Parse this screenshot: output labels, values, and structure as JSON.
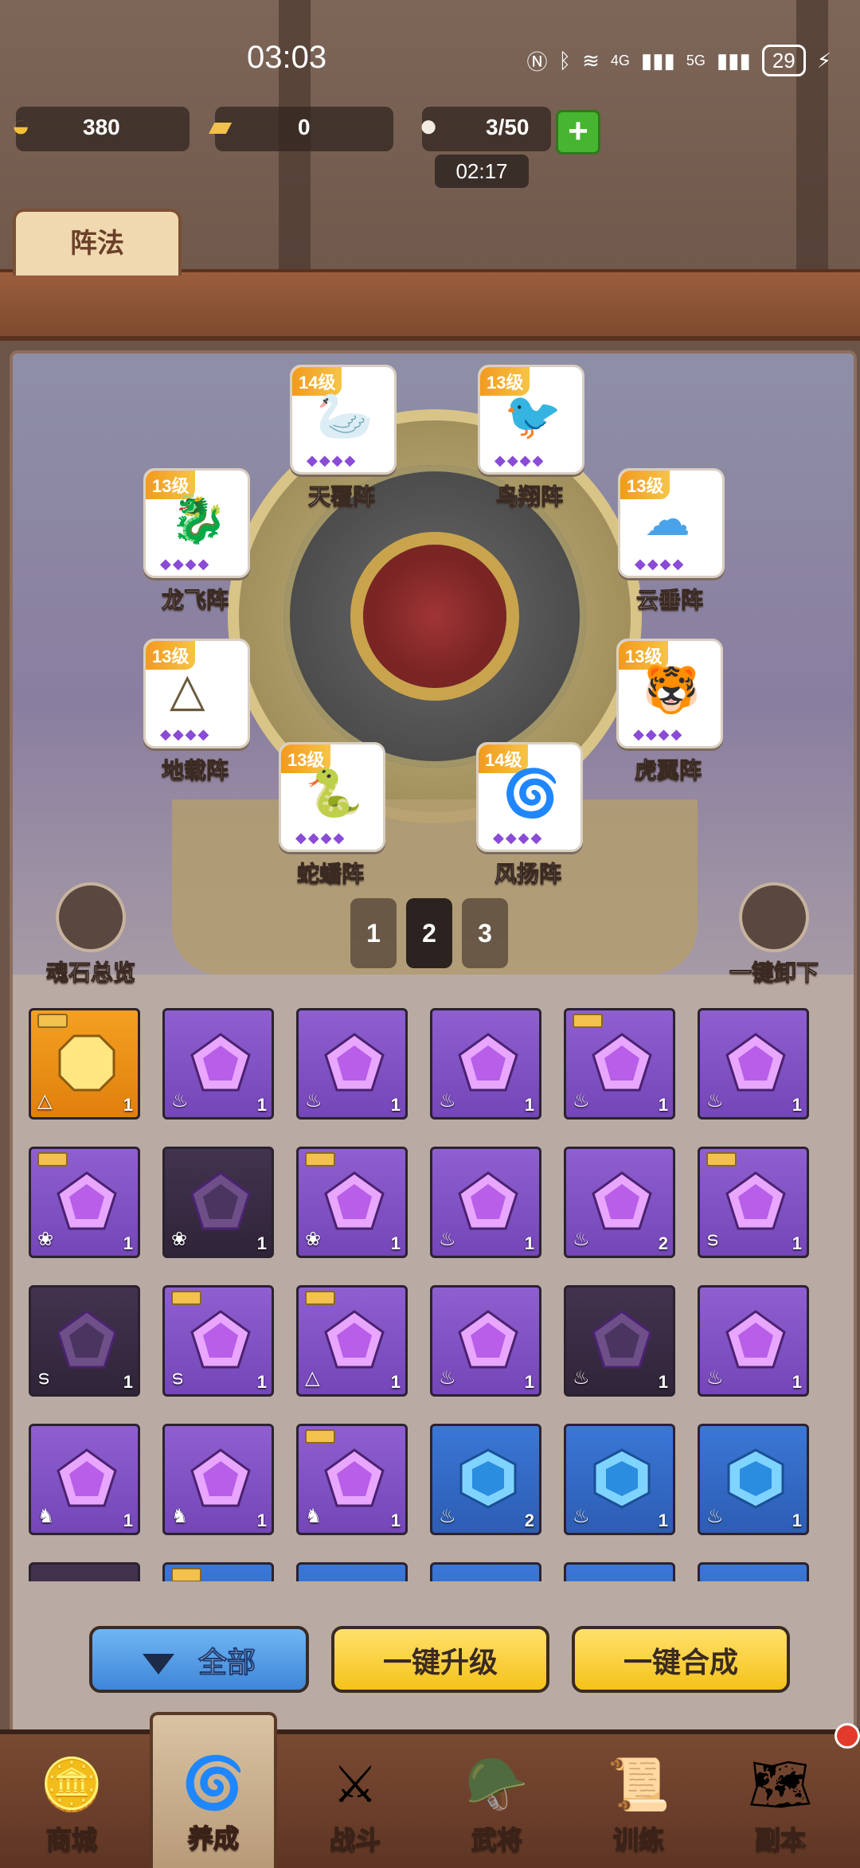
{
  "status": {
    "time": "03:03",
    "network": "4G",
    "network2": "5G",
    "battery": "29"
  },
  "resources": {
    "gold": "380",
    "ticket": "0",
    "stamina": "3/50",
    "timer": "02:17"
  },
  "tab": {
    "title": "阵法"
  },
  "formations": [
    {
      "name": "天覆阵",
      "level": "14级",
      "glyph": "🦢",
      "color": "#d9c06a",
      "gems": "◆◆◆◆"
    },
    {
      "name": "鸟翔阵",
      "level": "13级",
      "glyph": "🐦",
      "color": "#c62d2d",
      "gems": "◆◆◆◆"
    },
    {
      "name": "龙飞阵",
      "level": "13级",
      "glyph": "🐉",
      "color": "#e88a2a",
      "gems": "◆◆◆◆"
    },
    {
      "name": "云垂阵",
      "level": "13级",
      "glyph": "☁",
      "color": "#4aa3e8",
      "gems": "◆◆◆◆"
    },
    {
      "name": "地载阵",
      "level": "13级",
      "glyph": "△",
      "color": "#6b5a3c",
      "gems": "◆◆◆◆"
    },
    {
      "name": "虎翼阵",
      "level": "13级",
      "glyph": "🐯",
      "color": "#e8b14a",
      "gems": "◆◆◆◆"
    },
    {
      "name": "蛇蟠阵",
      "level": "13级",
      "glyph": "🐍",
      "color": "#8a4bd6",
      "gems": "◆◆◆◆"
    },
    {
      "name": "风扬阵",
      "level": "14级",
      "glyph": "🌀",
      "color": "#2fb88a",
      "gems": "◆◆◆◆"
    }
  ],
  "pages": [
    "1",
    "2",
    "3"
  ],
  "side": {
    "left": "魂石总览",
    "right": "一键卸下"
  },
  "gems": [
    {
      "t": "orange",
      "c": "1",
      "s": "△",
      "tag": true
    },
    {
      "t": "purple",
      "c": "1",
      "s": "♨",
      "tag": false
    },
    {
      "t": "purple",
      "c": "1",
      "s": "♨",
      "tag": false
    },
    {
      "t": "purple",
      "c": "1",
      "s": "♨",
      "tag": false
    },
    {
      "t": "purple",
      "c": "1",
      "s": "♨",
      "tag": true
    },
    {
      "t": "purple",
      "c": "1",
      "s": "♨",
      "tag": false
    },
    {
      "t": "purple",
      "c": "1",
      "s": "❀",
      "tag": true
    },
    {
      "t": "dark",
      "c": "1",
      "s": "❀",
      "tag": false
    },
    {
      "t": "purple",
      "c": "1",
      "s": "❀",
      "tag": true
    },
    {
      "t": "purple",
      "c": "1",
      "s": "♨",
      "tag": false
    },
    {
      "t": "purple",
      "c": "2",
      "s": "♨",
      "tag": false
    },
    {
      "t": "purple",
      "c": "1",
      "s": "ട",
      "tag": true
    },
    {
      "t": "dark",
      "c": "1",
      "s": "ട",
      "tag": false
    },
    {
      "t": "purple",
      "c": "1",
      "s": "ട",
      "tag": true
    },
    {
      "t": "purple",
      "c": "1",
      "s": "△",
      "tag": true
    },
    {
      "t": "purple",
      "c": "1",
      "s": "♨",
      "tag": false
    },
    {
      "t": "dark",
      "c": "1",
      "s": "♨",
      "tag": false
    },
    {
      "t": "purple",
      "c": "1",
      "s": "♨",
      "tag": false
    },
    {
      "t": "purple",
      "c": "1",
      "s": "♞",
      "tag": false
    },
    {
      "t": "purple",
      "c": "1",
      "s": "♞",
      "tag": false
    },
    {
      "t": "purple",
      "c": "1",
      "s": "♞",
      "tag": true
    },
    {
      "t": "blue",
      "c": "2",
      "s": "♨",
      "tag": false
    },
    {
      "t": "blue",
      "c": "1",
      "s": "♨",
      "tag": false
    },
    {
      "t": "blue",
      "c": "1",
      "s": "♨",
      "tag": false
    },
    {
      "t": "dark",
      "c": "",
      "s": "",
      "tag": false
    },
    {
      "t": "blue",
      "c": "",
      "s": "",
      "tag": true
    },
    {
      "t": "blue",
      "c": "",
      "s": "",
      "tag": false
    },
    {
      "t": "blue",
      "c": "",
      "s": "",
      "tag": false
    },
    {
      "t": "blue",
      "c": "",
      "s": "",
      "tag": false
    },
    {
      "t": "blue",
      "c": "",
      "s": "",
      "tag": false
    }
  ],
  "buttons": {
    "all": "全部",
    "upgrade": "一键升级",
    "merge": "一键合成"
  },
  "nav": [
    {
      "label": "商城",
      "icon": "🪙"
    },
    {
      "label": "养成",
      "icon": "🌀"
    },
    {
      "label": "战斗",
      "icon": "⚔"
    },
    {
      "label": "武将",
      "icon": "🪖"
    },
    {
      "label": "训练",
      "icon": "📜"
    },
    {
      "label": "副本",
      "icon": "🗺"
    }
  ]
}
